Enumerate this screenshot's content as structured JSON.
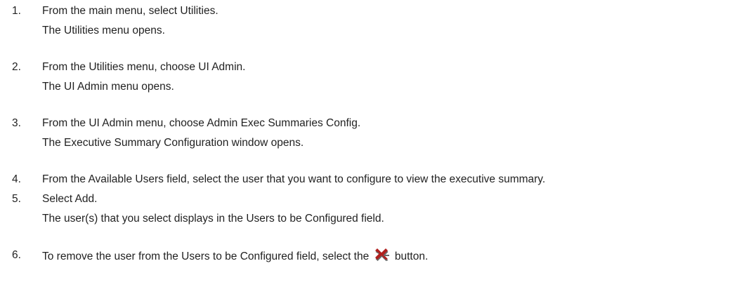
{
  "steps": [
    {
      "number": "1.",
      "text": "From the main menu, select Utilities.",
      "result": "The Utilities menu opens."
    },
    {
      "number": "2.",
      "text": "From the Utilities menu, choose UI Admin.",
      "result": "The UI Admin  menu opens."
    },
    {
      "number": "3.",
      "text": "From the UI Admin menu, choose Admin Exec Summaries Config.",
      "result": "The Executive Summary Configuration window opens."
    },
    {
      "number": "4.",
      "text": "From the Available Users field, select the user that you want to configure to view the executive summary."
    },
    {
      "number": "5.",
      "text": "Select Add.",
      "result": "The user(s) that you select displays in the Users to be Configured field."
    },
    {
      "number": "6.",
      "text_before_icon": "To remove the user from the Users to be Configured field, select the",
      "icon": "remove-user-icon",
      "text_after_icon": "button."
    }
  ],
  "colors": {
    "text": "#222222",
    "remove_icon": "#b0201e",
    "remove_icon_shadow": "#6a6a6a"
  }
}
